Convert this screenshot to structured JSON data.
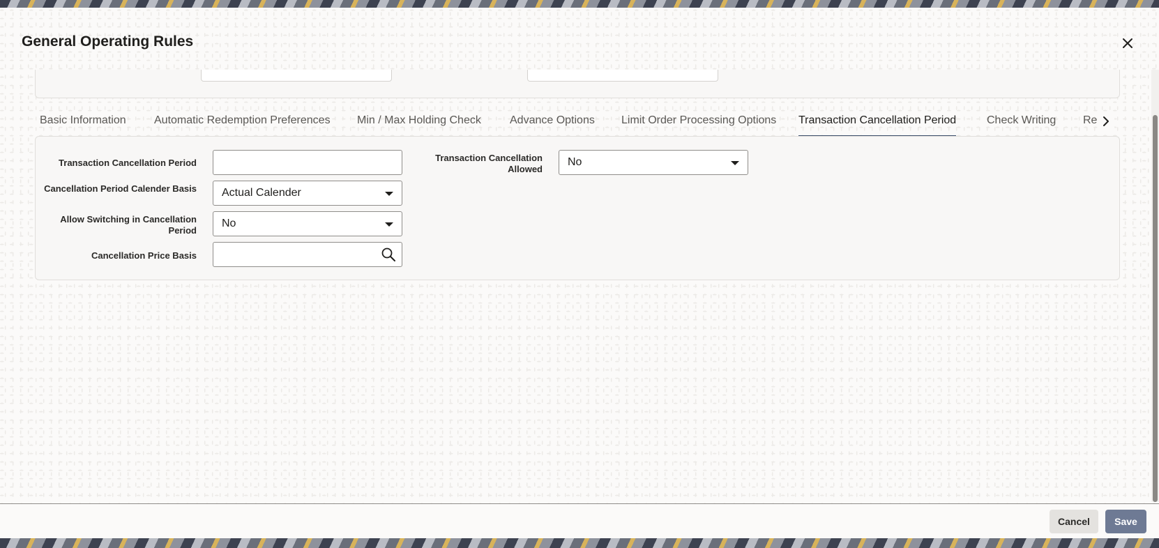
{
  "dialog": {
    "title": "General Operating Rules",
    "close_icon": "close-icon"
  },
  "tabs": [
    {
      "label": "Basic Information",
      "active": false
    },
    {
      "label": "Automatic Redemption Preferences",
      "active": false
    },
    {
      "label": "Min / Max Holding Check",
      "active": false
    },
    {
      "label": "Advance Options",
      "active": false
    },
    {
      "label": "Limit Order Processing Options",
      "active": false
    },
    {
      "label": "Transaction Cancellation Period",
      "active": true
    },
    {
      "label": "Check Writing",
      "active": false
    },
    {
      "label": "Re",
      "active": false
    }
  ],
  "form": {
    "transaction_cancellation_period": {
      "label": "Transaction Cancellation Period",
      "value": ""
    },
    "cancellation_period_calender_basis": {
      "label": "Cancellation Period Calender Basis",
      "value": "Actual Calender"
    },
    "allow_switching": {
      "label": "Allow Switching in Cancellation Period",
      "value": "No"
    },
    "cancellation_price_basis": {
      "label": "Cancellation Price Basis",
      "value": ""
    },
    "transaction_cancellation_allowed": {
      "label": "Transaction Cancellation Allowed",
      "value": "No"
    }
  },
  "footer": {
    "cancel_label": "Cancel",
    "save_label": "Save"
  },
  "colors": {
    "active_tab_underline": "#3d4f6b",
    "save_button": "#6e7a94"
  }
}
